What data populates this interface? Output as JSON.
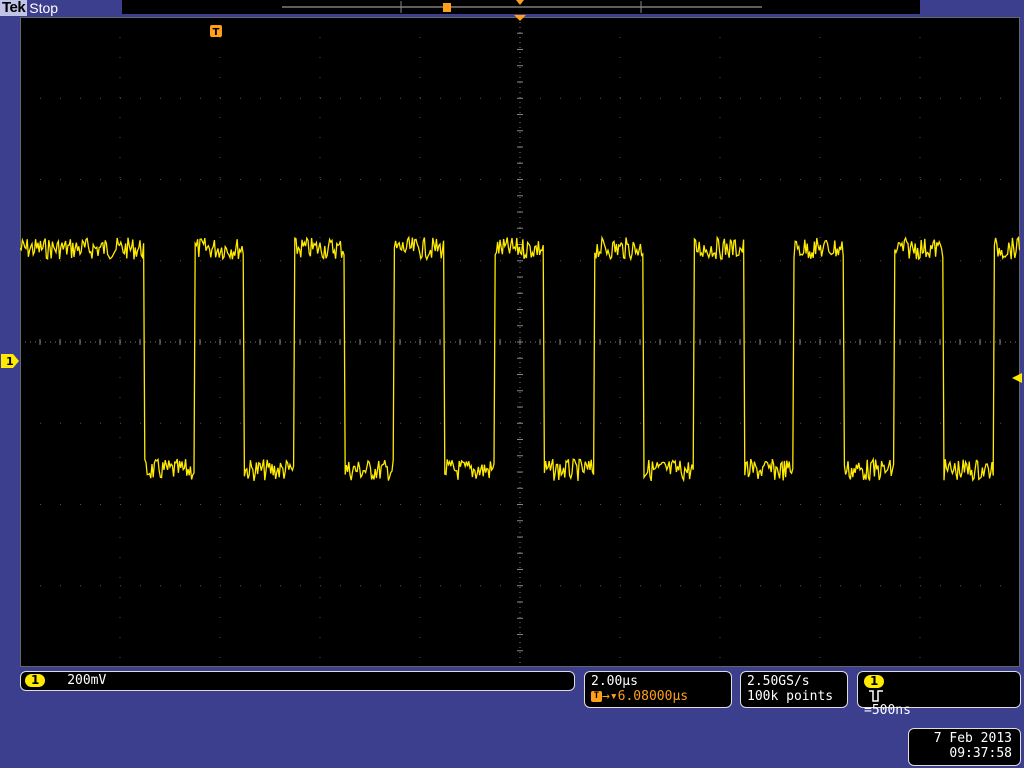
{
  "header": {
    "brand": "Tek",
    "state": "Stop"
  },
  "colors": {
    "trace": "#ffea00",
    "trigger": "#ff9f1a",
    "background": "#3b3f8e"
  },
  "channel": {
    "number": "1",
    "scale": "200mV"
  },
  "timebase": {
    "per_div": "2.00µs",
    "trigger_position": "6.08000µs"
  },
  "acquisition": {
    "sample_rate": "2.50GS/s",
    "record_length": "100k points"
  },
  "trigger": {
    "channel": "1",
    "type_icon": "pulse-width-icon",
    "condition": "=500ns",
    "marker": "T"
  },
  "datetime": {
    "date": "7 Feb  2013",
    "time": "09:37:58"
  },
  "signal": {
    "high_div": 1.6,
    "low_div": -1.6,
    "idle_until_div": 2.5,
    "period_div": 1.0,
    "duty": 0.5,
    "first_low_at_div": 2.5
  }
}
